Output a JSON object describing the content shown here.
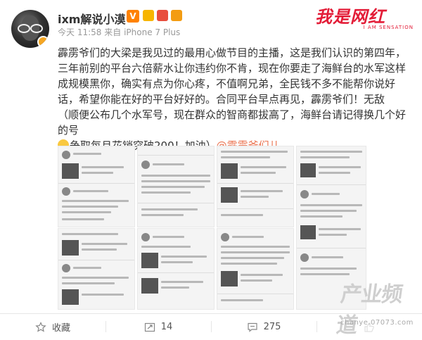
{
  "author": {
    "name": "ixm解说小漠",
    "verified_mark": "V",
    "time": "今天 11:58",
    "source_prefix": "来自",
    "source": "iPhone 7 Plus"
  },
  "brand": {
    "text": "我是网红",
    "sub": "I AM SENSATION"
  },
  "post": {
    "text_main": "霹雳爷们的大梁是我见过的最用心做节目的主播，这是我们认识的第四年，三年前别的平台六倍薪水让你违约你不肯，现在你要走了海鲜台的水军这样成规模黑你，确实有点为你心疼，不值啊兄弟，全民钱不多不能帮你说好话，希望你能在好的平台好好的。合同平台早点再见，霹雳爷们！无敌",
    "text_paren": "（顺便公布几个水军号，现在群众的智商都拔高了，海鲜台请记得换几个好的号",
    "text_end": "争取每月花销突破200！加油）",
    "mention": "@霹雳爷们儿"
  },
  "watermark": {
    "text": "产业频道",
    "url": "chanye.07073.com"
  },
  "actions": {
    "favorite": "收藏",
    "repost": "14",
    "comment": "275"
  },
  "colors": {
    "brand_red": "#e31c37",
    "mention": "#eb7350",
    "verified": "#ff8200"
  }
}
